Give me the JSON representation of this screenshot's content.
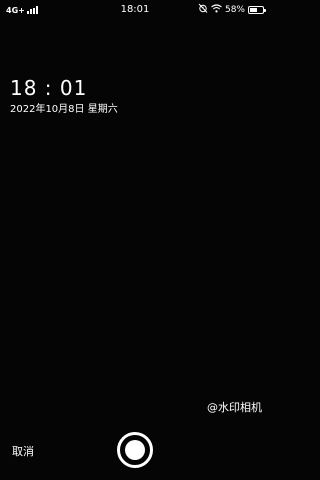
{
  "status_bar": {
    "network": "4G+",
    "time": "18:01",
    "battery_percent_text": "58%",
    "battery_level": 0.58
  },
  "watermark": {
    "time": "18 : 01",
    "date": "2022年10月8日 星期六",
    "brand": "@水印相机"
  },
  "controls": {
    "cancel_label": "取消"
  },
  "icons": {
    "signal": "signal-bars-icon",
    "alarm": "alarm-off-icon",
    "wifi": "wifi-icon",
    "battery": "battery-icon",
    "shutter": "shutter-icon"
  }
}
